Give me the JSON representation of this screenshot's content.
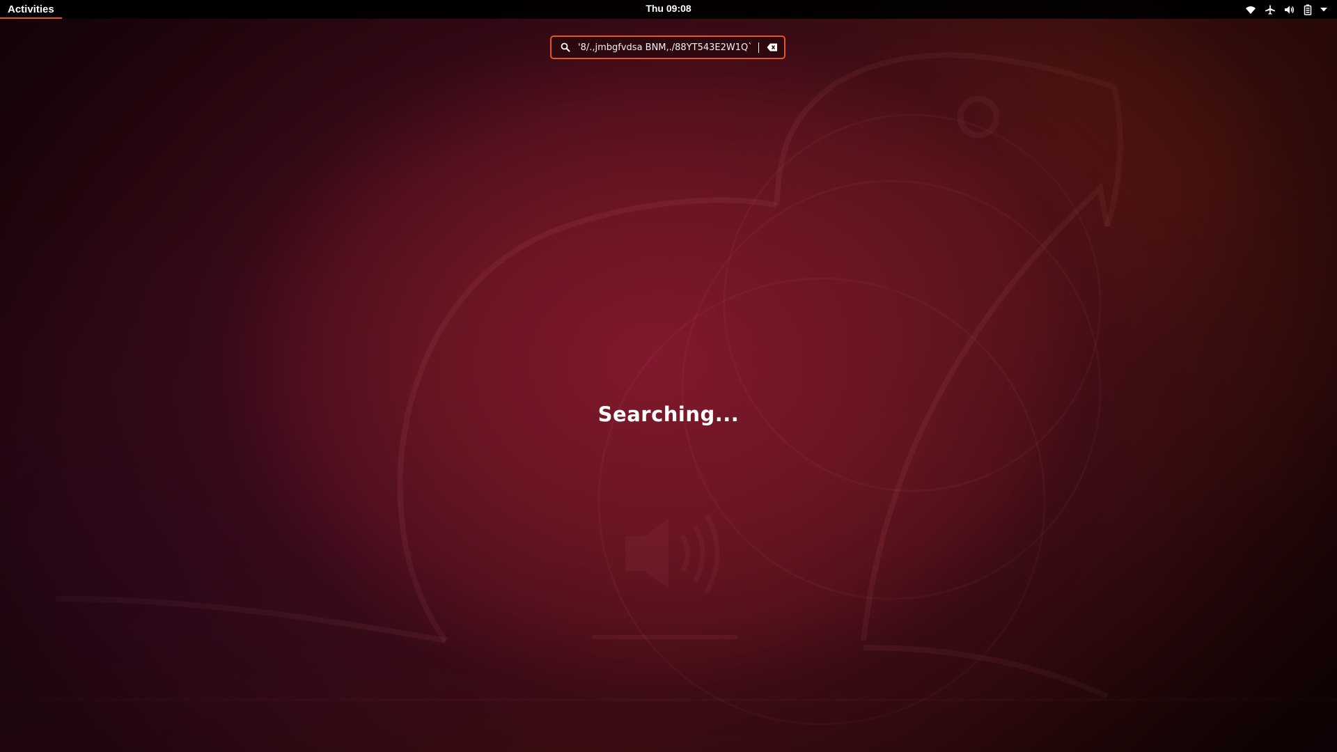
{
  "top_bar": {
    "activities_label": "Activities",
    "clock": "Thu 09:08",
    "tray_icons": [
      "wifi-icon",
      "airplane-mode-icon",
      "volume-icon",
      "battery-icon",
      "menu-arrow-icon"
    ]
  },
  "search": {
    "value": "'8/.,jmbgfvdsa BNM,./88YT543E2W1Q`",
    "icon": "search-icon",
    "clear_icon": "clear-text-icon"
  },
  "overview": {
    "status_text": "Searching..."
  },
  "colors": {
    "accent": "#e95420",
    "panel": "#000000",
    "wallpaper_center": "#7a1a2a"
  }
}
